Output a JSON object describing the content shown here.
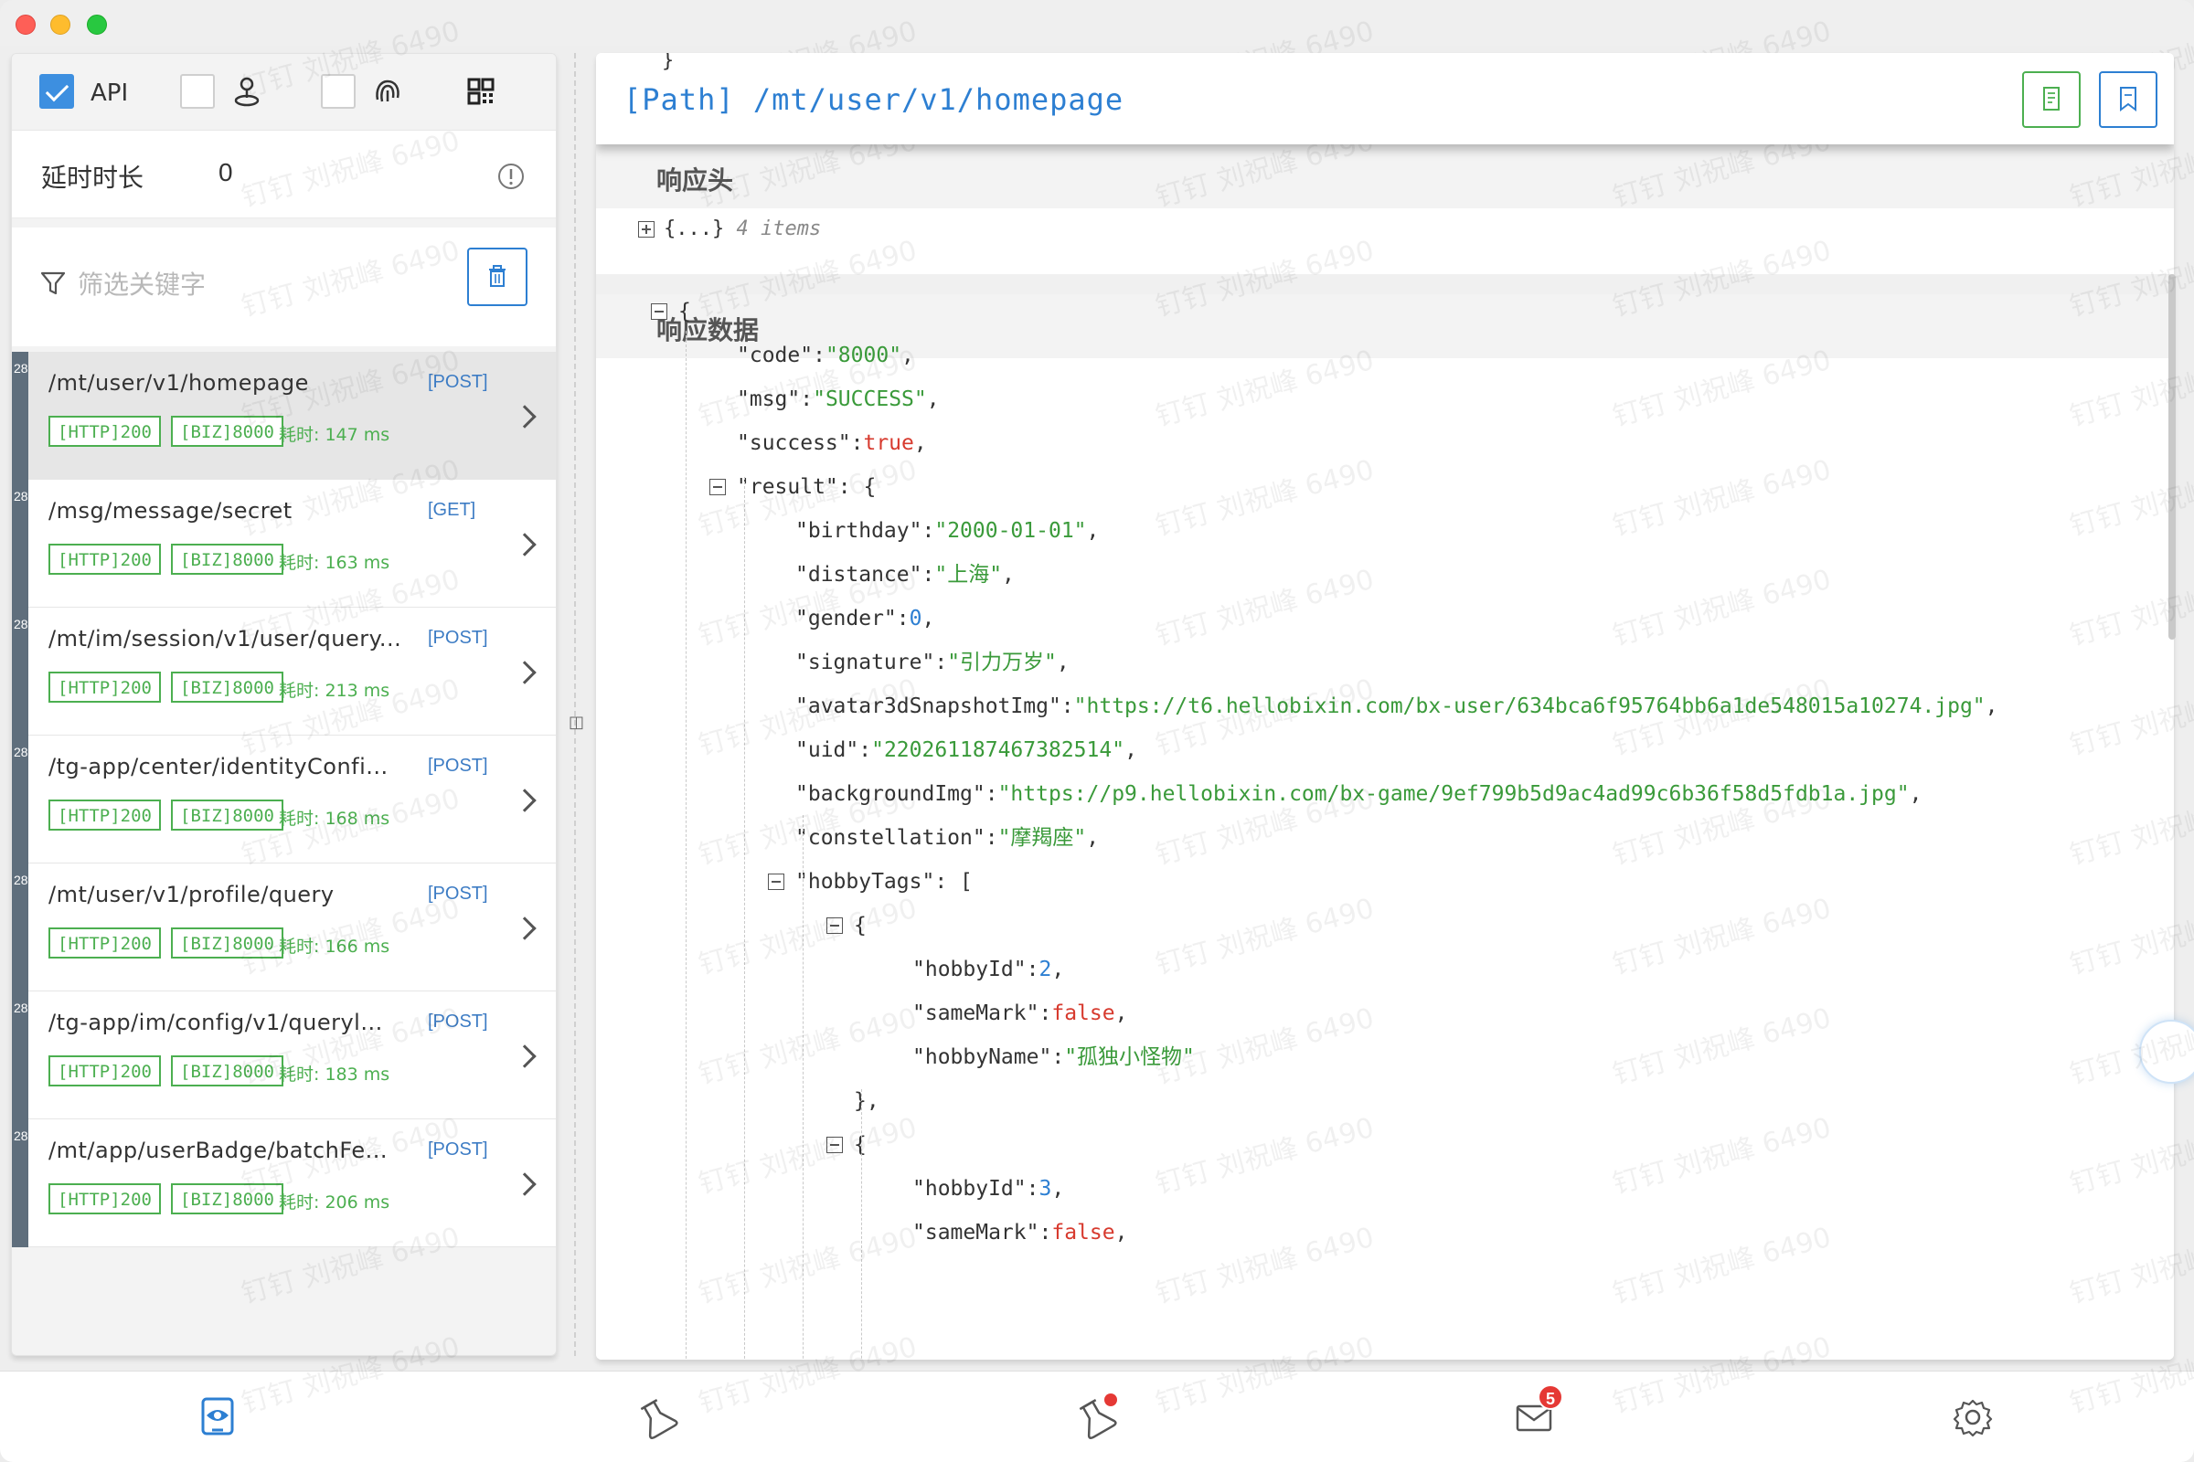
{
  "toolbar": {
    "api_label": "API",
    "api_checked": true
  },
  "delay": {
    "label": "延时时长",
    "value": "0"
  },
  "filter": {
    "placeholder": "筛选关键字"
  },
  "requests": [
    {
      "num": "28",
      "path": "/mt/user/v1/homepage",
      "method": "[POST]",
      "http": "[HTTP]200",
      "biz": "[BIZ]8000",
      "time": "耗时: 147 ms",
      "selected": true
    },
    {
      "num": "28",
      "path": "/msg/message/secret",
      "method": "[GET]",
      "http": "[HTTP]200",
      "biz": "[BIZ]8000",
      "time": "耗时: 163 ms",
      "selected": false
    },
    {
      "num": "28",
      "path": "/mt/im/session/v1/user/query...",
      "method": "[POST]",
      "http": "[HTTP]200",
      "biz": "[BIZ]8000",
      "time": "耗时: 213 ms",
      "selected": false
    },
    {
      "num": "28",
      "path": "/tg-app/center/identityConfi...",
      "method": "[POST]",
      "http": "[HTTP]200",
      "biz": "[BIZ]8000",
      "time": "耗时: 168 ms",
      "selected": false
    },
    {
      "num": "28",
      "path": "/mt/user/v1/profile/query",
      "method": "[POST]",
      "http": "[HTTP]200",
      "biz": "[BIZ]8000",
      "time": "耗时: 166 ms",
      "selected": false
    },
    {
      "num": "28",
      "path": "/tg-app/im/config/v1/queryl...",
      "method": "[POST]",
      "http": "[HTTP]200",
      "biz": "[BIZ]8000",
      "time": "耗时: 183 ms",
      "selected": false
    },
    {
      "num": "28",
      "path": "/mt/app/userBadge/batchFe...",
      "method": "[POST]",
      "http": "[HTTP]200",
      "biz": "[BIZ]8000",
      "time": "耗时: 206 ms",
      "selected": false
    }
  ],
  "detail": {
    "prev_brace": "}",
    "path": "[Path] /mt/user/v1/homepage",
    "headers_title": "响应头",
    "headers_collapsed": "{...}",
    "headers_count": "4 items",
    "data_title": "响应数据"
  },
  "json_lines": [
    {
      "indent": 0,
      "fold": true,
      "parts": [
        [
          "jpunc",
          "{"
        ]
      ]
    },
    {
      "indent": 1,
      "parts": [
        [
          "jkey",
          "\"code\""
        ],
        [
          "jpunc",
          ":"
        ],
        [
          "jstr",
          "\"8000\""
        ],
        [
          "jpunc",
          ","
        ]
      ]
    },
    {
      "indent": 1,
      "parts": [
        [
          "jkey",
          "\"msg\""
        ],
        [
          "jpunc",
          ":"
        ],
        [
          "jstr",
          "\"SUCCESS\""
        ],
        [
          "jpunc",
          ","
        ]
      ]
    },
    {
      "indent": 1,
      "parts": [
        [
          "jkey",
          "\"success\""
        ],
        [
          "jpunc",
          ":"
        ],
        [
          "jbool",
          "true"
        ],
        [
          "jpunc",
          ","
        ]
      ]
    },
    {
      "indent": 1,
      "fold": true,
      "parts": [
        [
          "jkey",
          "\"result\""
        ],
        [
          "jpunc",
          ": {"
        ]
      ]
    },
    {
      "indent": 2,
      "parts": [
        [
          "jkey",
          "\"birthday\""
        ],
        [
          "jpunc",
          ":"
        ],
        [
          "jstr",
          "\"2000-01-01\""
        ],
        [
          "jpunc",
          ","
        ]
      ]
    },
    {
      "indent": 2,
      "parts": [
        [
          "jkey",
          "\"distance\""
        ],
        [
          "jpunc",
          ":"
        ],
        [
          "jstr",
          "\"上海\""
        ],
        [
          "jpunc",
          ","
        ]
      ]
    },
    {
      "indent": 2,
      "parts": [
        [
          "jkey",
          "\"gender\""
        ],
        [
          "jpunc",
          ":"
        ],
        [
          "jnum",
          "0"
        ],
        [
          "jpunc",
          ","
        ]
      ]
    },
    {
      "indent": 2,
      "parts": [
        [
          "jkey",
          "\"signature\""
        ],
        [
          "jpunc",
          ":"
        ],
        [
          "jstr",
          "\"引力万岁\""
        ],
        [
          "jpunc",
          ","
        ]
      ]
    },
    {
      "indent": 2,
      "parts": [
        [
          "jkey",
          "\"avatar3dSnapshotImg\""
        ],
        [
          "jpunc",
          ":"
        ],
        [
          "jstr",
          "\"https://t6.hellobixin.com/bx-user/634bca6f95764bb6a1de548015a10274.jpg\""
        ],
        [
          "jpunc",
          ","
        ]
      ]
    },
    {
      "indent": 2,
      "parts": [
        [
          "jkey",
          "\"uid\""
        ],
        [
          "jpunc",
          ":"
        ],
        [
          "jstr",
          "\"220261187467382514\""
        ],
        [
          "jpunc",
          ","
        ]
      ]
    },
    {
      "indent": 2,
      "parts": [
        [
          "jkey",
          "\"backgroundImg\""
        ],
        [
          "jpunc",
          ":"
        ],
        [
          "jstr",
          "\"https://p9.hellobixin.com/bx-game/9ef799b5d9ac4ad99c6b36f58d5fdb1a.jpg\""
        ],
        [
          "jpunc",
          ","
        ]
      ]
    },
    {
      "indent": 2,
      "parts": [
        [
          "jkey",
          "\"constellation\""
        ],
        [
          "jpunc",
          ":"
        ],
        [
          "jstr",
          "\"摩羯座\""
        ],
        [
          "jpunc",
          ","
        ]
      ]
    },
    {
      "indent": 2,
      "fold": true,
      "parts": [
        [
          "jkey",
          "\"hobbyTags\""
        ],
        [
          "jpunc",
          ": ["
        ]
      ]
    },
    {
      "indent": 3,
      "fold": true,
      "parts": [
        [
          "jpunc",
          "{"
        ]
      ]
    },
    {
      "indent": 4,
      "parts": [
        [
          "jkey",
          "\"hobbyId\""
        ],
        [
          "jpunc",
          ":"
        ],
        [
          "jnum",
          "2"
        ],
        [
          "jpunc",
          ","
        ]
      ]
    },
    {
      "indent": 4,
      "parts": [
        [
          "jkey",
          "\"sameMark\""
        ],
        [
          "jpunc",
          ":"
        ],
        [
          "jbool",
          "false"
        ],
        [
          "jpunc",
          ","
        ]
      ]
    },
    {
      "indent": 4,
      "parts": [
        [
          "jkey",
          "\"hobbyName\""
        ],
        [
          "jpunc",
          ":"
        ],
        [
          "jstr",
          "\"孤独小怪物\""
        ]
      ]
    },
    {
      "indent": 3,
      "parts": [
        [
          "jpunc",
          "},"
        ]
      ]
    },
    {
      "indent": 3,
      "fold": true,
      "parts": [
        [
          "jpunc",
          "{"
        ]
      ]
    },
    {
      "indent": 4,
      "parts": [
        [
          "jkey",
          "\"hobbyId\""
        ],
        [
          "jpunc",
          ":"
        ],
        [
          "jnum",
          "3"
        ],
        [
          "jpunc",
          ","
        ]
      ]
    },
    {
      "indent": 4,
      "parts": [
        [
          "jkey",
          "\"sameMark\""
        ],
        [
          "jpunc",
          ":"
        ],
        [
          "jbool",
          "false"
        ],
        [
          "jpunc",
          ","
        ]
      ]
    }
  ],
  "bottom_nav": {
    "mail_badge": "5"
  },
  "watermark_text": "钉钉 刘祝峰 6490",
  "colors": {
    "accent": "#2d7fd2",
    "success": "#4caf50",
    "error": "#e53935"
  }
}
